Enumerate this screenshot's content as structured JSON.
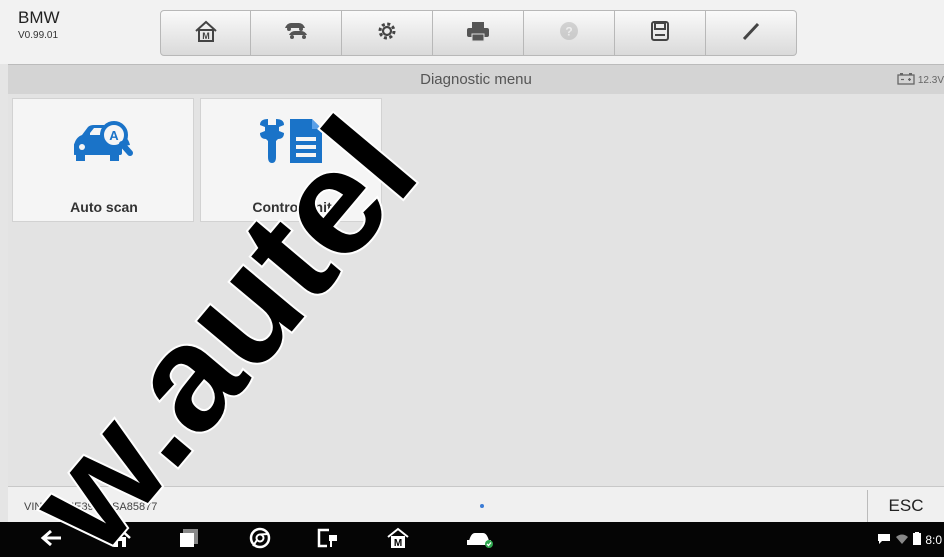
{
  "header": {
    "brand": "BMW",
    "version": "V0.99.01"
  },
  "toolbar": [
    {
      "icon": "home-icon"
    },
    {
      "icon": "vehicle-swap-icon"
    },
    {
      "icon": "gear-icon"
    },
    {
      "icon": "printer-icon"
    },
    {
      "icon": "help-icon"
    },
    {
      "icon": "save-icon"
    },
    {
      "icon": "pencil-icon"
    }
  ],
  "menu": {
    "title": "Diagnostic menu",
    "voltage": "12.3V"
  },
  "cards": [
    {
      "label": "Auto scan",
      "icon": "auto-scan-icon"
    },
    {
      "label": "Control unit",
      "icon": "control-unit-icon"
    }
  ],
  "status": {
    "vin": "VIN:LBVNE39055SA85877",
    "esc": "ESC"
  },
  "system": {
    "time": "8:0"
  },
  "watermark": "w.autel",
  "colors": {
    "accent": "#1a73c8"
  }
}
